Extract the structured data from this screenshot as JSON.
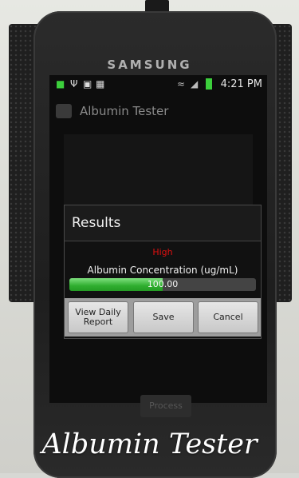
{
  "phone": {
    "brand": "SAMSUNG"
  },
  "status_bar": {
    "time": "4:21 PM",
    "icons": [
      "android-icon",
      "usb-icon",
      "sd-card-icon",
      "image-icon",
      "wifi-icon",
      "signal-icon",
      "battery-icon"
    ]
  },
  "app": {
    "title": "Albumin Tester"
  },
  "dialog": {
    "title": "Results",
    "result": "High",
    "concentration_label": "Albumin Concentration (ug/mL)",
    "concentration_value": "100.00",
    "progress_fraction": 0.5,
    "buttons": {
      "view_report": "View Daily Report",
      "save": "Save",
      "cancel": "Cancel"
    }
  },
  "process_button": "Process",
  "caption": "Albumin Tester",
  "colors": {
    "result_high": "#e01010",
    "progress": "#2fae2f",
    "battery": "#3ccf3c"
  }
}
